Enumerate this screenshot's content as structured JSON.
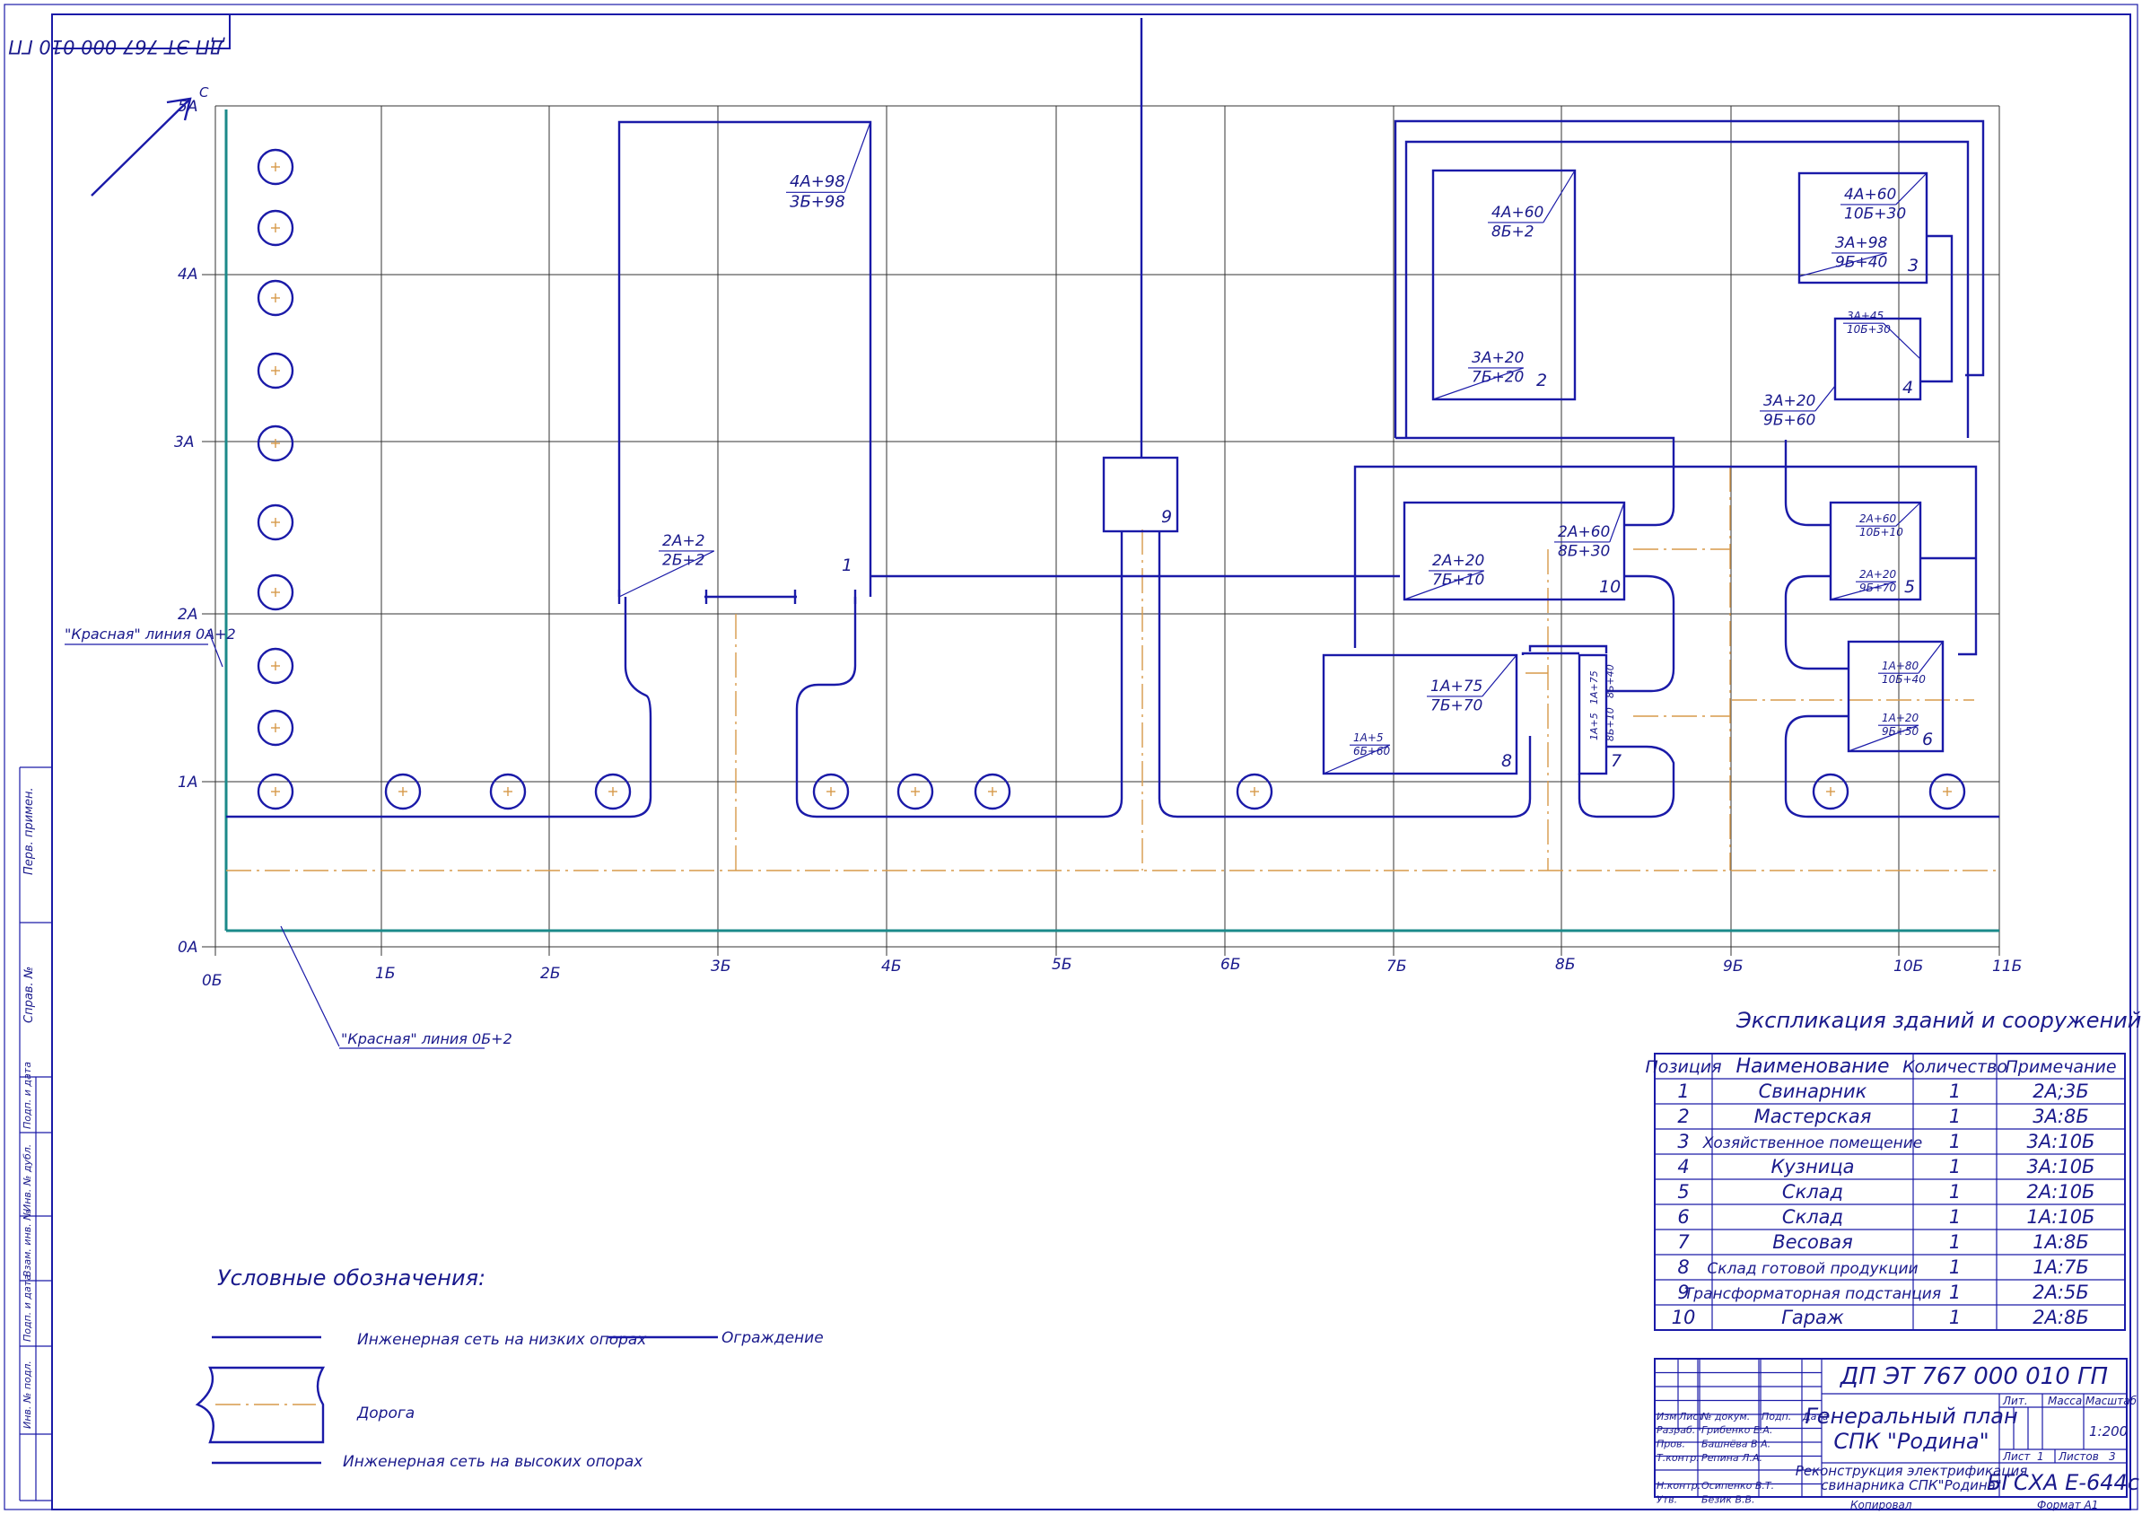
{
  "doc_code": "ДП ЭТ 767 000 010 ГП",
  "north": "С",
  "axis_y": [
    "0А",
    "1А",
    "2А",
    "3А",
    "4А",
    "5А"
  ],
  "axis_x": [
    "0Б",
    "1Б",
    "2Б",
    "3Б",
    "4Б",
    "5Б",
    "6Б",
    "7Б",
    "8Б",
    "9Б",
    "10Б",
    "11Б"
  ],
  "red_line_a": "\"Красная\" линия 0А+2",
  "red_line_b": "\"Красная\" линия 0Б+2",
  "building_numbers": [
    "1",
    "2",
    "3",
    "4",
    "5",
    "6",
    "7",
    "8",
    "9",
    "10"
  ],
  "coords": {
    "b1_top": [
      "4А+98",
      "3Б+98"
    ],
    "b1_bot": [
      "2А+2",
      "2Б+2"
    ],
    "b2_top": [
      "4А+60",
      "8Б+2"
    ],
    "b2_bot": [
      "3А+20",
      "7Б+20"
    ],
    "b3_top": [
      "4А+60",
      "10Б+30"
    ],
    "b3_bot": [
      "3А+98",
      "9Б+40"
    ],
    "b4_top": [
      "3А+45",
      "10Б+30"
    ],
    "b4_bot": [
      "3А+20",
      "9Б+60"
    ],
    "b10_top": [
      "2А+60",
      "8Б+30"
    ],
    "b10_bot": [
      "2А+20",
      "7Б+10"
    ],
    "b5_top": [
      "2А+60",
      "10Б+10"
    ],
    "b5_bot": [
      "2А+20",
      "9Б+70"
    ],
    "b6_top": [
      "1А+80",
      "10Б+40"
    ],
    "b6_bot": [
      "1А+20",
      "9Б+50"
    ],
    "b8_top": [
      "1А+75",
      "7Б+70"
    ],
    "b8_bot": [
      "1А+5",
      "6Б+60"
    ],
    "b7_top": [
      "1А+75",
      "8Б+40"
    ],
    "b7_bot": [
      "1А+5",
      "8Б+10"
    ]
  },
  "legend": {
    "title": "Условные обозначения:",
    "low_poles": "Инженерная сеть на низких опорах",
    "fence": "Ограждение",
    "road": "Дорога",
    "high_poles": "Инженерная сеть на высоких опорах"
  },
  "explication": {
    "title": "Экспликация зданий и сооружений",
    "headers": [
      "Позиция",
      "Наименование",
      "Количество",
      "Примечание"
    ],
    "rows": [
      [
        "1",
        "Свинарник",
        "1",
        "2А;3Б"
      ],
      [
        "2",
        "Мастерская",
        "1",
        "3А:8Б"
      ],
      [
        "3",
        "Хозяйственное помещение",
        "1",
        "3А:10Б"
      ],
      [
        "4",
        "Кузница",
        "1",
        "3А:10Б"
      ],
      [
        "5",
        "Склад",
        "1",
        "2А:10Б"
      ],
      [
        "6",
        "Склад",
        "1",
        "1А:10Б"
      ],
      [
        "7",
        "Весовая",
        "1",
        "1А:8Б"
      ],
      [
        "8",
        "Склад готовой продукции",
        "1",
        "1А:7Б"
      ],
      [
        "9",
        "Трансформаторная подстанция",
        "1",
        "2А:5Б"
      ],
      [
        "10",
        "Гараж",
        "1",
        "2А:8Б"
      ]
    ]
  },
  "stamp": {
    "code": "ДП ЭТ 767 000 010 ГП",
    "title1": "Генеральный план",
    "title2": "СПК \"Родина\"",
    "subtitle1": "Реконструкция электрификация",
    "subtitle2": "свинарника СПК\"Родина\"",
    "org": "БГСХА Е-644с",
    "col_headers": [
      "Изм",
      "Лист",
      "№ докум.",
      "Подп.",
      "Дата"
    ],
    "people": [
      [
        "Разраб.",
        "Грибенко Е.А."
      ],
      [
        "Пров.",
        "Башнёва В.А."
      ],
      [
        "Т.контр.",
        "Репина Л.А."
      ],
      [
        "",
        ""
      ],
      [
        "Н.контр.",
        "Осипенко В.Т."
      ],
      [
        "Утв.",
        "Безик В.В."
      ]
    ],
    "lit": "Лит.",
    "mass": "Масса",
    "scale_label": "Масштаб",
    "scale": "1:200",
    "sheet_label": "Лист",
    "sheet": "1",
    "sheets_label": "Листов",
    "sheets": "3",
    "copied": "Копировал",
    "format": "Формат   А1"
  },
  "side_labels": [
    "Перв. примен.",
    "Справ. №",
    "Подп. и дата",
    "Инв. № дубл.",
    "Взам. инв. №",
    "Подп. и дата",
    "Инв. № подл."
  ],
  "colors": {
    "lines": "#1a1aa8",
    "road": "#d79a4a",
    "red_line": "#1b8a8a",
    "text": "#1a1a8c"
  }
}
